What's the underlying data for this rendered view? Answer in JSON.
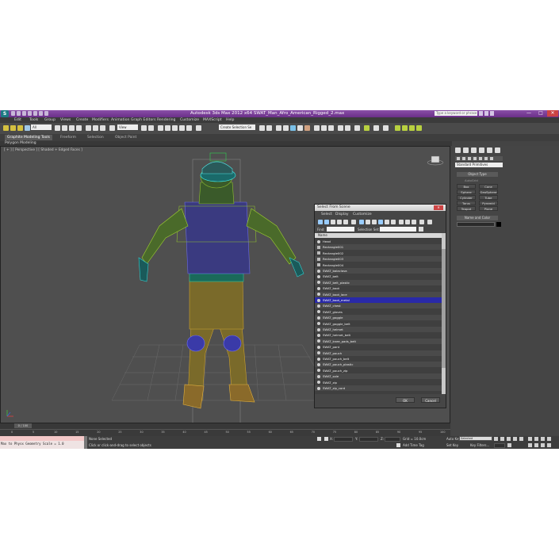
{
  "window": {
    "title": "Autodesk 3ds Max 2012 x64      SWAT_Man_Afro_American_Rigged_2.max",
    "app_icon": "3dsmax-logo-icon",
    "search_placeholder": "Type a keyword or phrase",
    "controls": [
      "—",
      "□",
      "✕"
    ]
  },
  "menubar": [
    "Edit",
    "Tools",
    "Group",
    "Views",
    "Create",
    "Modifiers",
    "Animation",
    "Graph Editors",
    "Rendering",
    "Customize",
    "MAXScript",
    "Help"
  ],
  "toolbar": {
    "selection_filter": "All",
    "reference_coord": "View",
    "named_selection": "Create Selection Se"
  },
  "ribbon": {
    "tabs": [
      "Graphite Modeling Tools",
      "Freeform",
      "Selection",
      "Object Paint"
    ],
    "active_tab": 0,
    "sub": "Polygon Modeling"
  },
  "viewport": {
    "label": "[ + ] [ Perspective ] [ Shaded + Edged Faces ]"
  },
  "command_panel": {
    "category": "Standard Primitives",
    "rollouts": [
      "Object Type",
      "Name and Color"
    ],
    "autogrid": "AutoGrid",
    "objects": [
      "Box",
      "Cone",
      "Sphere",
      "GeoSphere",
      "Cylinder",
      "Tube",
      "Torus",
      "Pyramid",
      "Teapot",
      "Plane"
    ]
  },
  "dialog": {
    "title": "Select From Scene",
    "menu": [
      "Select",
      "Display",
      "Customize"
    ],
    "find_label": "Find:",
    "selection_set_label": "Selection Set:",
    "column_header": "Name",
    "items": [
      {
        "name": "Head",
        "icon": "bone-icon"
      },
      {
        "name": "Rectangle001",
        "icon": "shape-icon"
      },
      {
        "name": "Rectangle002",
        "icon": "shape-icon"
      },
      {
        "name": "Rectangle003",
        "icon": "shape-icon"
      },
      {
        "name": "Rectangle004",
        "icon": "shape-icon"
      },
      {
        "name": "SWAT_balaclava",
        "icon": "geometry-icon"
      },
      {
        "name": "SWAT_belt",
        "icon": "geometry-icon"
      },
      {
        "name": "SWAT_belt_plastic",
        "icon": "geometry-icon"
      },
      {
        "name": "SWAT_boot",
        "icon": "geometry-icon"
      },
      {
        "name": "SWAT_boot_lace",
        "icon": "geometry-icon"
      },
      {
        "name": "SWAT_boot_metal",
        "icon": "geometry-icon"
      },
      {
        "name": "SWAT_chest",
        "icon": "geometry-icon"
      },
      {
        "name": "SWAT_gloves",
        "icon": "geometry-icon"
      },
      {
        "name": "SWAT_goggle",
        "icon": "geometry-icon"
      },
      {
        "name": "SWAT_goggle_belt",
        "icon": "geometry-icon"
      },
      {
        "name": "SWAT_helmet",
        "icon": "geometry-icon"
      },
      {
        "name": "SWAT_helmet_belt",
        "icon": "geometry-icon"
      },
      {
        "name": "SWAT_knee_pads_belt",
        "icon": "geometry-icon"
      },
      {
        "name": "SWAT_pant",
        "icon": "geometry-icon"
      },
      {
        "name": "SWAT_pouch",
        "icon": "geometry-icon"
      },
      {
        "name": "SWAT_pouch_belt",
        "icon": "geometry-icon"
      },
      {
        "name": "SWAT_pouch_plastic",
        "icon": "geometry-icon"
      },
      {
        "name": "SWAT_pouch_zip",
        "icon": "geometry-icon"
      },
      {
        "name": "SWAT_sole",
        "icon": "geometry-icon"
      },
      {
        "name": "SWAT_zip",
        "icon": "geometry-icon"
      },
      {
        "name": "SWAT_zip_cord",
        "icon": "geometry-icon"
      }
    ],
    "selected_index": 10,
    "ok_label": "OK",
    "cancel_label": "Cancel"
  },
  "timeline": {
    "frame_label": "0 / 100",
    "ticks": [
      "0",
      "5",
      "10",
      "15",
      "20",
      "25",
      "30",
      "35",
      "40",
      "45",
      "50",
      "55",
      "60",
      "65",
      "70",
      "75",
      "80",
      "85",
      "90",
      "95",
      "100"
    ]
  },
  "status": {
    "script_line": "Max to Physx Geometry Scale = 1.0",
    "selection": "None Selected",
    "prompt": "Click or click-and-drag to select objects",
    "x_label": "X:",
    "y_label": "Y:",
    "z_label": "Z:",
    "grid": "Grid = 10.0cm",
    "add_time_tag": "Add Time Tag",
    "auto_key": "Auto Key",
    "auto_key_value": "Selected",
    "set_key": "Set Key",
    "key_filters": "Key Filters..."
  },
  "colors": {
    "title_bar": "#7a3f98",
    "selection_highlight": "#2929a8",
    "viewport_bg": "#4f4f4f"
  }
}
